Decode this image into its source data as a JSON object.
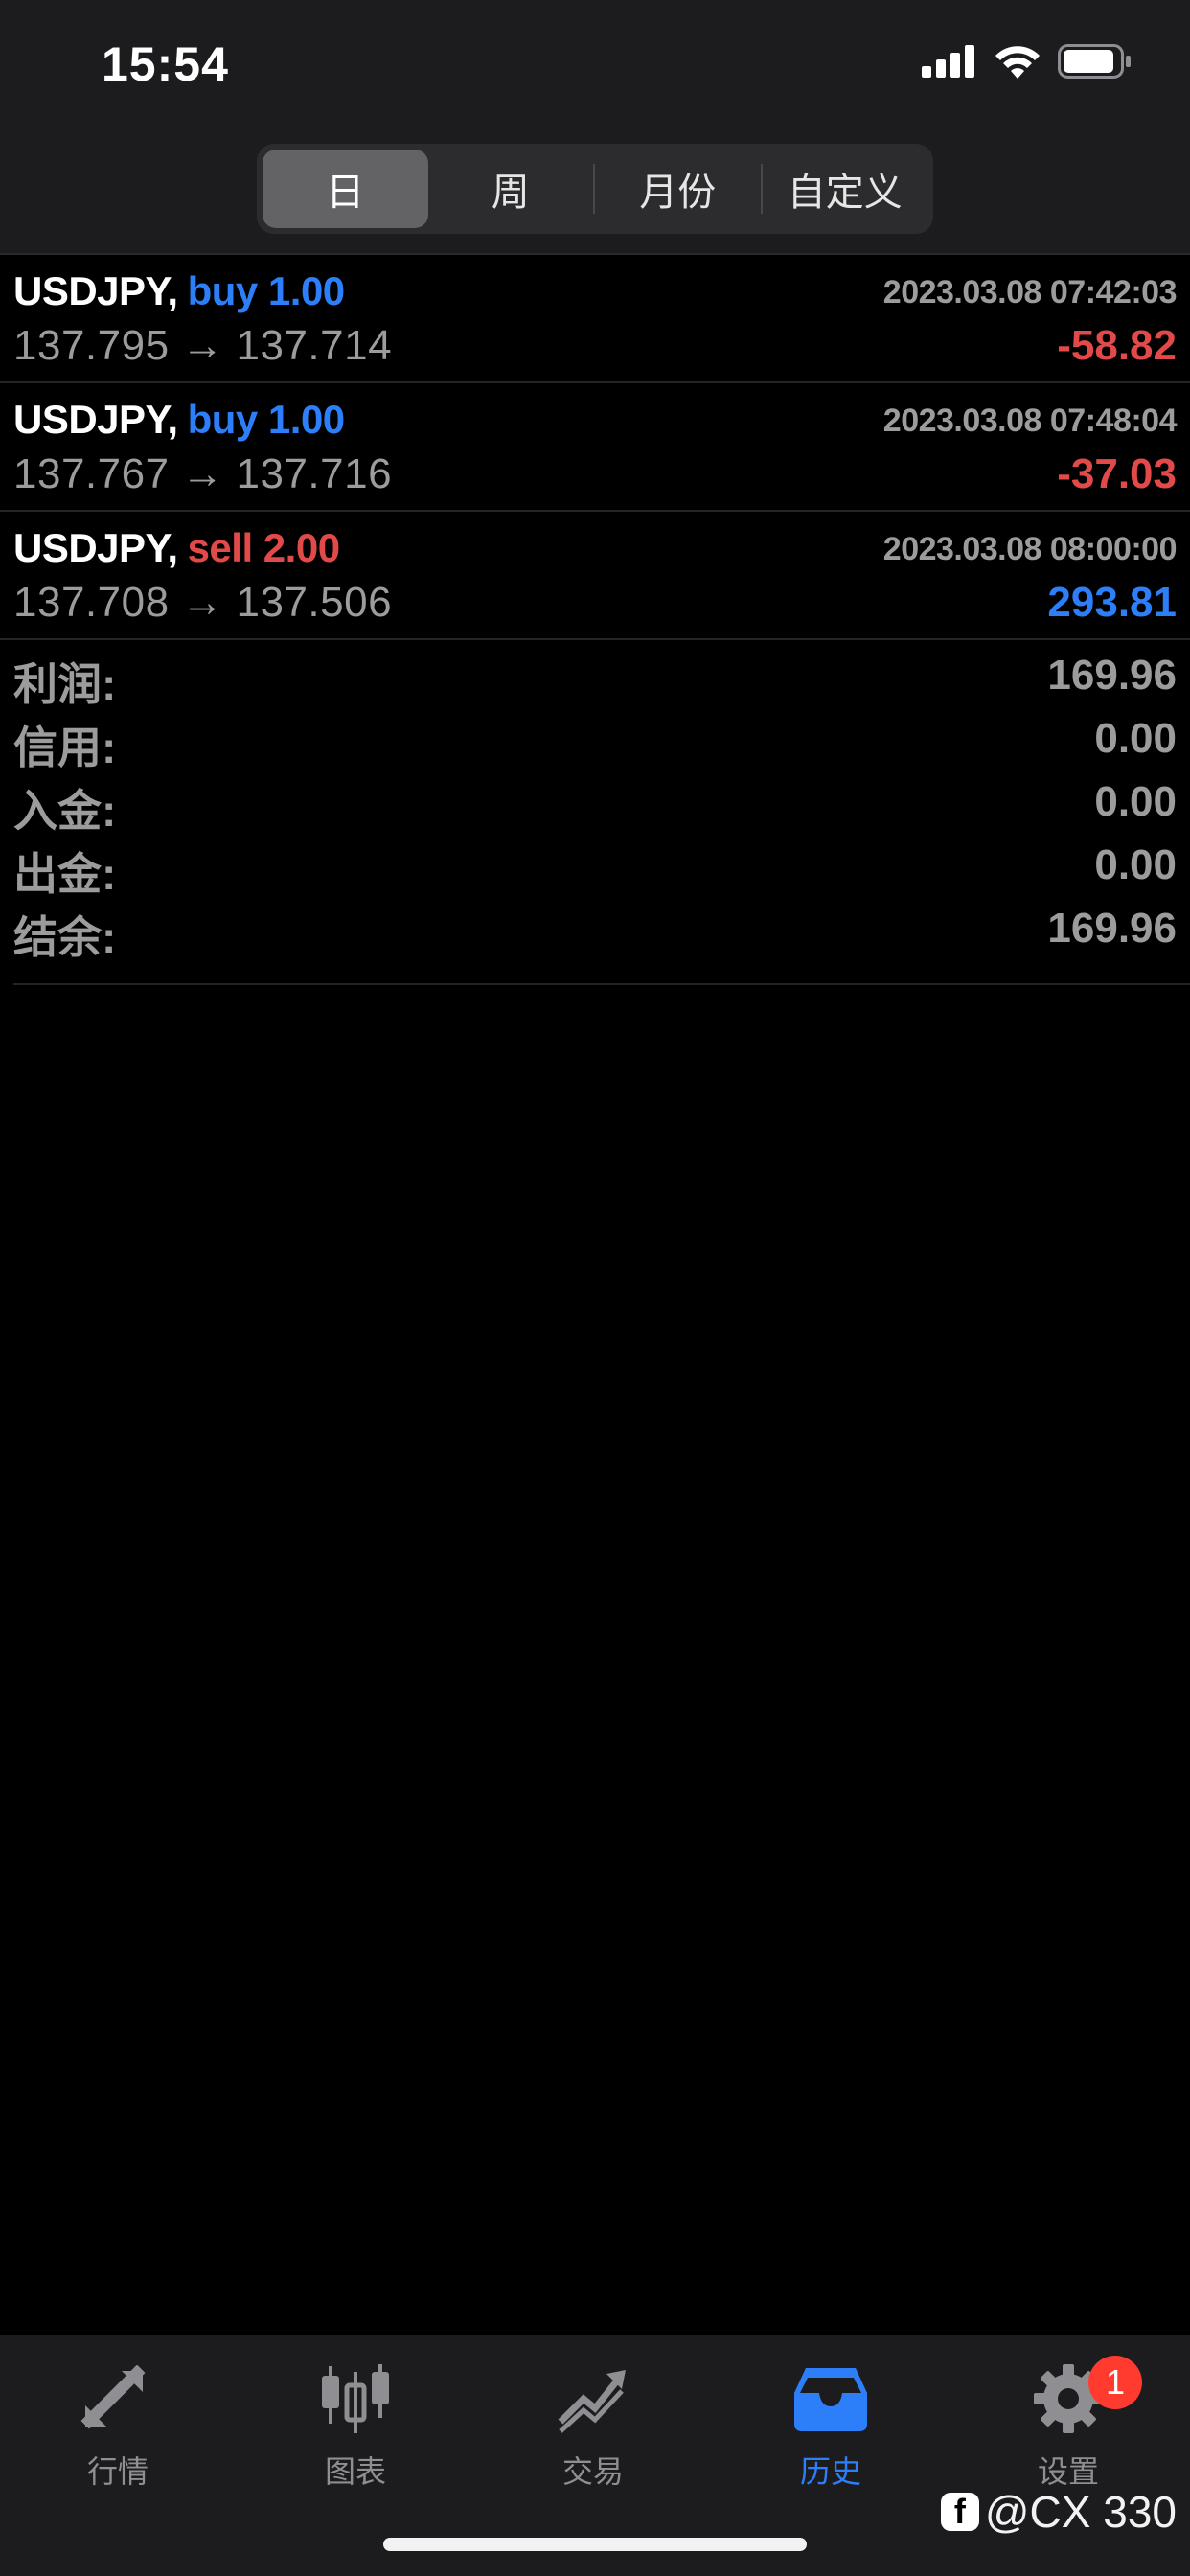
{
  "status": {
    "time": "15:54"
  },
  "segments": [
    {
      "label": "日",
      "active": true
    },
    {
      "label": "周",
      "active": false
    },
    {
      "label": "月份",
      "active": false
    },
    {
      "label": "自定义",
      "active": false
    }
  ],
  "trades": [
    {
      "symbol": "USDJPY,",
      "side": "buy 1.00",
      "side_type": "buy",
      "time": "2023.03.08 07:42:03",
      "prices": "137.795 → 137.714",
      "profit": "-58.82"
    },
    {
      "symbol": "USDJPY,",
      "side": "buy 1.00",
      "side_type": "buy",
      "time": "2023.03.08 07:48:04",
      "prices": "137.767 → 137.716",
      "profit": "-37.03"
    },
    {
      "symbol": "USDJPY,",
      "side": "sell 2.00",
      "side_type": "sell",
      "time": "2023.03.08 08:00:00",
      "prices": "137.708 → 137.506",
      "profit": "293.81"
    }
  ],
  "summary": [
    {
      "label": "利润:",
      "value": "169.96"
    },
    {
      "label": "信用:",
      "value": "0.00"
    },
    {
      "label": "入金:",
      "value": "0.00"
    },
    {
      "label": "出金:",
      "value": "0.00"
    },
    {
      "label": "结余:",
      "value": "169.96"
    }
  ],
  "tabs": [
    {
      "label": "行情",
      "icon": "quotes-arrows-icon",
      "active": false
    },
    {
      "label": "图表",
      "icon": "candlestick-chart-icon",
      "active": false
    },
    {
      "label": "交易",
      "icon": "trade-trend-icon",
      "active": false
    },
    {
      "label": "历史",
      "icon": "history-inbox-icon",
      "active": true
    },
    {
      "label": "设置",
      "icon": "gear-icon",
      "active": false,
      "badge": "1"
    }
  ],
  "watermark": "@CX 330",
  "colors": {
    "buy": "#2d7ff9",
    "sell": "#e24a4a",
    "tab_active": "#2d7ff9",
    "badge": "#ff3b30"
  }
}
